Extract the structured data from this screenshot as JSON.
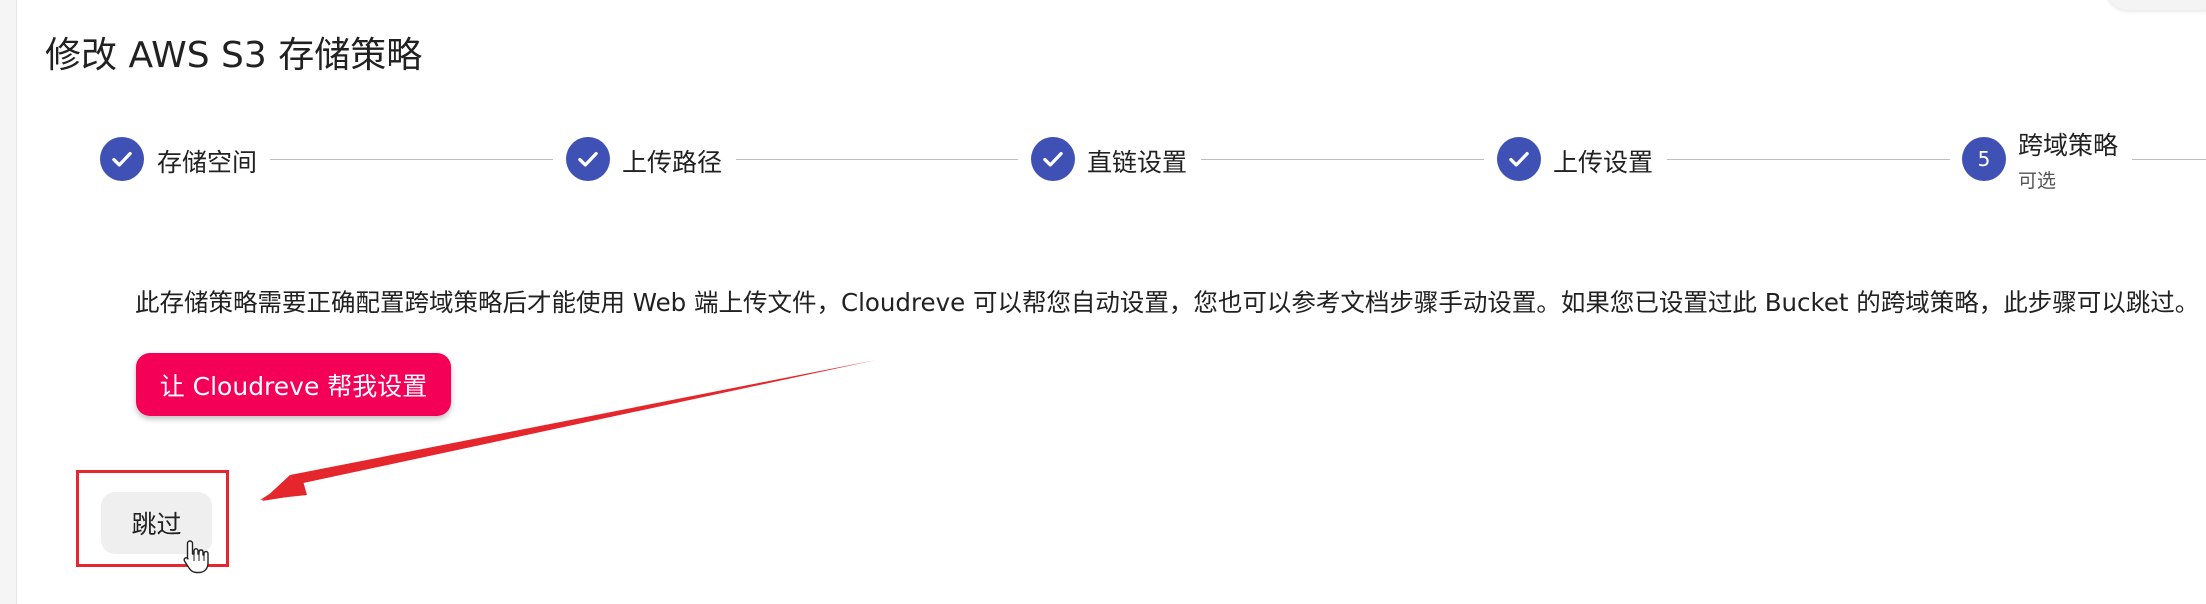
{
  "page": {
    "title": "修改 AWS S3 存储策略"
  },
  "stepper": {
    "steps": [
      {
        "number": "1",
        "label": "存储空间",
        "completed": true,
        "icon": "check-icon"
      },
      {
        "number": "2",
        "label": "上传路径",
        "completed": true,
        "icon": "check-icon"
      },
      {
        "number": "3",
        "label": "直链设置",
        "completed": true,
        "icon": "check-icon"
      },
      {
        "number": "4",
        "label": "上传设置",
        "completed": true,
        "icon": "check-icon"
      },
      {
        "number": "5",
        "label": "跨域策略",
        "sublabel": "可选",
        "completed": false,
        "active": true
      }
    ]
  },
  "main": {
    "description": "此存储策略需要正确配置跨域策略后才能使用 Web 端上传文件，Cloudreve 可以帮您自动设置，您也可以参考文档步骤手动设置。如果您已设置过此 Bucket 的跨域策略，此步骤可以跳过。",
    "auto_config_label": "让 Cloudreve 帮我设置",
    "skip_label": "跳过"
  },
  "colors": {
    "primary": "#3f51b5",
    "secondary": "#f50057",
    "annotation": "#e5262d",
    "connector": "#bdbdbd"
  }
}
